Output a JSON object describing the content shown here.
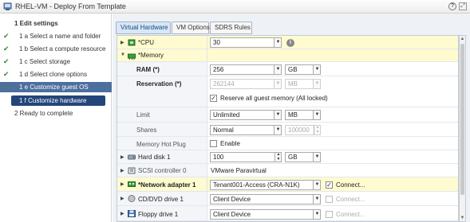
{
  "window": {
    "title": "RHEL-VM - Deploy From Template"
  },
  "steps": [
    {
      "label": "1  Edit settings",
      "done": false,
      "kind": "group"
    },
    {
      "label": "1 a  Select a name and folder",
      "done": true,
      "kind": "sub"
    },
    {
      "label": "1 b  Select a compute resource",
      "done": true,
      "kind": "sub"
    },
    {
      "label": "1 c  Select storage",
      "done": true,
      "kind": "sub"
    },
    {
      "label": "1 d  Select clone options",
      "done": true,
      "kind": "sub"
    },
    {
      "label": "1 e  Customize guest OS",
      "done": true,
      "kind": "active"
    },
    {
      "label": "1 f  Customize hardware",
      "done": false,
      "kind": "current"
    },
    {
      "label": "2  Ready to complete",
      "done": false,
      "kind": "ready"
    }
  ],
  "tabs": [
    {
      "label": "Virtual Hardware",
      "selected": true
    },
    {
      "label": "VM Options",
      "selected": false
    },
    {
      "label": "SDRS Rules",
      "selected": false
    }
  ],
  "hardware": {
    "cpu": {
      "label": "*CPU",
      "value": "30"
    },
    "memory": {
      "label": "*Memory"
    },
    "ram": {
      "label": "RAM (*)",
      "value": "256",
      "unit": "GB"
    },
    "reservation": {
      "label": "Reservation (*)",
      "value": "262144",
      "unit": "MB"
    },
    "reserve_all": {
      "label": "Reserve all guest memory (All locked)",
      "checked": true
    },
    "limit": {
      "label": "Limit",
      "value": "Unlimited",
      "unit": "MB"
    },
    "shares": {
      "label": "Shares",
      "value": "Normal",
      "amount": "100000"
    },
    "hotplug": {
      "label": "Memory Hot Plug",
      "option": "Enable",
      "checked": false
    },
    "hard_disk": {
      "label": "Hard disk 1",
      "value": "100",
      "unit": "GB"
    },
    "scsi": {
      "label": "SCSI controller 0",
      "value": "VMware Paravirtual"
    },
    "network": {
      "label": "*Network adapter 1",
      "value": "Tenant001-Access (CRA-N1K)",
      "connect": "Connect...",
      "checked": true
    },
    "cddvd": {
      "label": "CD/DVD drive 1",
      "value": "Client Device",
      "connect": "Connect...",
      "checked": false
    },
    "floppy": {
      "label": "Floppy drive 1",
      "value": "Client Device",
      "connect": "Connect...",
      "checked": false
    }
  },
  "colors": {
    "accent": "#24457a",
    "selected_step": "#4c6f9e",
    "highlight_row": "#fffbd0",
    "check": "#3a8b3a"
  }
}
